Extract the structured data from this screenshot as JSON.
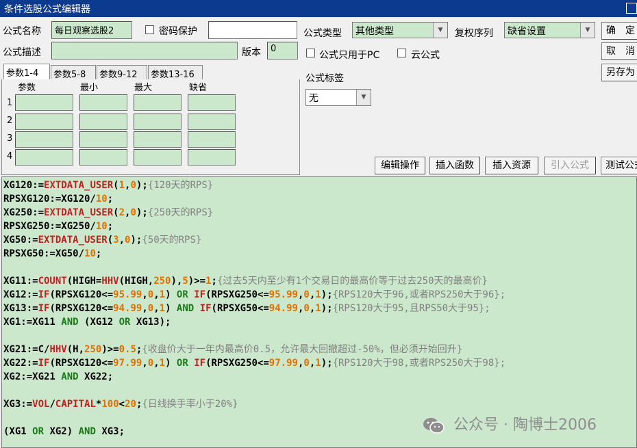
{
  "window": {
    "title": "条件选股公式编辑器"
  },
  "form": {
    "name_label": "公式名称",
    "name_value": "每日观察选股2",
    "password_label": "密码保护",
    "desc_label": "公式描述",
    "desc_value": "",
    "version_label": "版本",
    "version_value": "0",
    "type_label": "公式类型",
    "type_value": "其他类型",
    "fuquan_label": "复权序列",
    "fuquan_value": "缺省设置",
    "pc_only_label": "公式只用于PC",
    "cloud_label": "云公式",
    "tag_label": "公式标签",
    "tag_value": "无"
  },
  "buttons": {
    "ok": "确　定",
    "cancel": "取　消",
    "save_as": "另存为"
  },
  "tabs": [
    "参数1-4",
    "参数5-8",
    "参数9-12",
    "参数13-16"
  ],
  "param_headers": [
    "参数",
    "最小",
    "最大",
    "缺省"
  ],
  "param_rows": [
    "1",
    "2",
    "3",
    "4"
  ],
  "toolbar": [
    "编辑操作",
    "插入函数",
    "插入资源",
    "引入公式",
    "测试公式"
  ],
  "code_lines": [
    [
      [
        "t",
        "XG120:="
      ],
      [
        "f",
        "EXTDATA_USER"
      ],
      [
        "t",
        "("
      ],
      [
        "n",
        "1"
      ],
      [
        "t",
        ","
      ],
      [
        "n",
        "0"
      ],
      [
        "t",
        ");"
      ],
      [
        "c",
        "{120天的RPS}"
      ]
    ],
    [
      [
        "t",
        "RPSXG120:=XG120/"
      ],
      [
        "n",
        "10"
      ],
      [
        "t",
        ";"
      ]
    ],
    [
      [
        "t",
        "XG250:="
      ],
      [
        "f",
        "EXTDATA_USER"
      ],
      [
        "t",
        "("
      ],
      [
        "n",
        "2"
      ],
      [
        "t",
        ","
      ],
      [
        "n",
        "0"
      ],
      [
        "t",
        ");"
      ],
      [
        "c",
        "{250天的RPS}"
      ]
    ],
    [
      [
        "t",
        "RPSXG250:=XG250/"
      ],
      [
        "n",
        "10"
      ],
      [
        "t",
        ";"
      ]
    ],
    [
      [
        "t",
        "XG50:="
      ],
      [
        "f",
        "EXTDATA_USER"
      ],
      [
        "t",
        "("
      ],
      [
        "n",
        "3"
      ],
      [
        "t",
        ","
      ],
      [
        "n",
        "0"
      ],
      [
        "t",
        ");"
      ],
      [
        "c",
        "{50天的RPS}"
      ]
    ],
    [
      [
        "t",
        "RPSXG50:=XG50/"
      ],
      [
        "n",
        "10"
      ],
      [
        "t",
        ";"
      ]
    ],
    [],
    [
      [
        "t",
        "XG11:="
      ],
      [
        "f",
        "COUNT"
      ],
      [
        "t",
        "(HIGH="
      ],
      [
        "f",
        "HHV"
      ],
      [
        "t",
        "(HIGH,"
      ],
      [
        "n",
        "250"
      ],
      [
        "t",
        "),"
      ],
      [
        "n",
        "5"
      ],
      [
        "t",
        ")>="
      ],
      [
        "n",
        "1"
      ],
      [
        "t",
        ";"
      ],
      [
        "c",
        "{过去5天内至少有1个交易日的最高价等于过去250天的最高价}"
      ]
    ],
    [
      [
        "t",
        "XG12:="
      ],
      [
        "f",
        "IF"
      ],
      [
        "t",
        "(RPSXG120<="
      ],
      [
        "n",
        "95.99"
      ],
      [
        "t",
        ","
      ],
      [
        "n",
        "0"
      ],
      [
        "t",
        ","
      ],
      [
        "n",
        "1"
      ],
      [
        "t",
        ") "
      ],
      [
        "k",
        "OR"
      ],
      [
        "t",
        " "
      ],
      [
        "f",
        "IF"
      ],
      [
        "t",
        "(RPSXG250<="
      ],
      [
        "n",
        "95.99"
      ],
      [
        "t",
        ","
      ],
      [
        "n",
        "0"
      ],
      [
        "t",
        ","
      ],
      [
        "n",
        "1"
      ],
      [
        "t",
        ");"
      ],
      [
        "c",
        "{RPS120大于96,或者RPS250大于96};"
      ]
    ],
    [
      [
        "t",
        "XG13:="
      ],
      [
        "f",
        "IF"
      ],
      [
        "t",
        "(RPSXG120<="
      ],
      [
        "n",
        "94.99"
      ],
      [
        "t",
        ","
      ],
      [
        "n",
        "0"
      ],
      [
        "t",
        ","
      ],
      [
        "n",
        "1"
      ],
      [
        "t",
        ") "
      ],
      [
        "k",
        "AND"
      ],
      [
        "t",
        " "
      ],
      [
        "f",
        "IF"
      ],
      [
        "t",
        "(RPSXG50<="
      ],
      [
        "n",
        "94.99"
      ],
      [
        "t",
        ","
      ],
      [
        "n",
        "0"
      ],
      [
        "t",
        ","
      ],
      [
        "n",
        "1"
      ],
      [
        "t",
        ");"
      ],
      [
        "c",
        "{RPS120大于95,且RPS50大于95};"
      ]
    ],
    [
      [
        "t",
        "XG1:=XG11 "
      ],
      [
        "k",
        "AND"
      ],
      [
        "t",
        " (XG12 "
      ],
      [
        "k",
        "OR"
      ],
      [
        "t",
        " XG13);"
      ]
    ],
    [],
    [
      [
        "t",
        "XG21:=C/"
      ],
      [
        "f",
        "HHV"
      ],
      [
        "t",
        "(H,"
      ],
      [
        "n",
        "250"
      ],
      [
        "t",
        ")>="
      ],
      [
        "n",
        "0.5"
      ],
      [
        "t",
        ";"
      ],
      [
        "c",
        "{收盘价大于一年内最高价0.5，允许最大回撤超过-50%，但必须开始回升}"
      ]
    ],
    [
      [
        "t",
        "XG22:="
      ],
      [
        "f",
        "IF"
      ],
      [
        "t",
        "(RPSXG120<="
      ],
      [
        "n",
        "97.99"
      ],
      [
        "t",
        ","
      ],
      [
        "n",
        "0"
      ],
      [
        "t",
        ","
      ],
      [
        "n",
        "1"
      ],
      [
        "t",
        ") "
      ],
      [
        "k",
        "OR"
      ],
      [
        "t",
        " "
      ],
      [
        "f",
        "IF"
      ],
      [
        "t",
        "(RPSXG250<="
      ],
      [
        "n",
        "97.99"
      ],
      [
        "t",
        ","
      ],
      [
        "n",
        "0"
      ],
      [
        "t",
        ","
      ],
      [
        "n",
        "1"
      ],
      [
        "t",
        ");"
      ],
      [
        "c",
        "{RPS120大于98,或者RPS250大于98};"
      ]
    ],
    [
      [
        "t",
        "XG2:=XG21 "
      ],
      [
        "k",
        "AND"
      ],
      [
        "t",
        " XG22;"
      ]
    ],
    [],
    [
      [
        "t",
        "XG3:="
      ],
      [
        "f",
        "VOL"
      ],
      [
        "t",
        "/"
      ],
      [
        "f",
        "CAPITAL"
      ],
      [
        "t",
        "*"
      ],
      [
        "n",
        "100"
      ],
      [
        "t",
        "<"
      ],
      [
        "n",
        "20"
      ],
      [
        "t",
        ";"
      ],
      [
        "c",
        "{日线换手率小于20%}"
      ]
    ],
    [],
    [
      [
        "t",
        "(XG1 "
      ],
      [
        "k",
        "OR"
      ],
      [
        "t",
        " XG2) "
      ],
      [
        "k",
        "AND"
      ],
      [
        "t",
        " XG3;"
      ]
    ]
  ],
  "watermark": "公众号 · 陶博士2006",
  "colors": {
    "titlebar": "#0b3a8f",
    "editor_bg": "#cce8cc",
    "function": "#c02020",
    "keyword": "#1a7a1a",
    "number": "#e07000",
    "comment": "#808080"
  }
}
